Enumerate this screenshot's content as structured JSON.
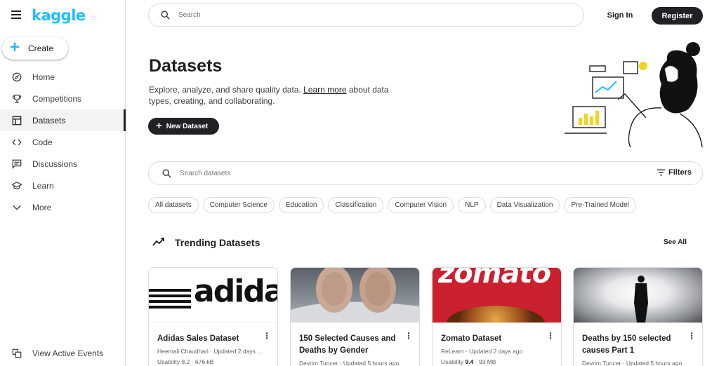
{
  "brand": "kaggle",
  "create_label": "Create",
  "nav": [
    {
      "label": "Home",
      "icon": "compass-icon"
    },
    {
      "label": "Competitions",
      "icon": "trophy-icon"
    },
    {
      "label": "Datasets",
      "icon": "table-icon"
    },
    {
      "label": "Code",
      "icon": "code-icon"
    },
    {
      "label": "Discussions",
      "icon": "comments-icon"
    },
    {
      "label": "Learn",
      "icon": "graduation-cap-icon"
    },
    {
      "label": "More",
      "icon": "chevron-down-icon"
    }
  ],
  "nav_active": "Datasets",
  "view_events": "View Active Events",
  "header": {
    "search_placeholder": "Search",
    "signin": "Sign In",
    "register": "Register"
  },
  "hero": {
    "title": "Datasets",
    "desc_before": "Explore, analyze, and share quality data. ",
    "desc_link": "Learn more",
    "desc_after": " about data types, creating, and collaborating.",
    "new_dataset": "New Dataset"
  },
  "dataset_search": {
    "placeholder": "Search datasets",
    "filters": "Filters"
  },
  "chips": [
    "All datasets",
    "Computer Science",
    "Education",
    "Classification",
    "Computer Vision",
    "NLP",
    "Data Visualization",
    "Pre-Trained Model"
  ],
  "trending": {
    "title": "Trending Datasets",
    "see_all": "See All",
    "cards": [
      {
        "title": "Adidas Sales Dataset",
        "author": "Heemali Chaudhari · Updated 2 days ...",
        "usability_label": "Usability",
        "usability": "8.2",
        "size": " · 676 kB",
        "thumb_text": "adidas"
      },
      {
        "title": "150 Selected Causes and Deaths by Gender",
        "author": "Devrim Tuncer · Updated 5 hours ago",
        "usability_label": "",
        "usability": "",
        "size": "",
        "thumb_text": ""
      },
      {
        "title": "Zomato Dataset",
        "author": "ReLearn · Updated 2 days ago",
        "usability_label": "Usability",
        "usability": "9.4",
        "size": " · 93 MB",
        "thumb_text": "zomato"
      },
      {
        "title": "Deaths by 150 selected causes Part 1",
        "author": "Devrim Tuncer · Updated 5 hours ago",
        "usability_label": "",
        "usability": "",
        "size": "",
        "thumb_text": ""
      }
    ]
  },
  "colors": {
    "brand": "#20beff",
    "dark": "#202124",
    "zomato": "#cb202d"
  }
}
